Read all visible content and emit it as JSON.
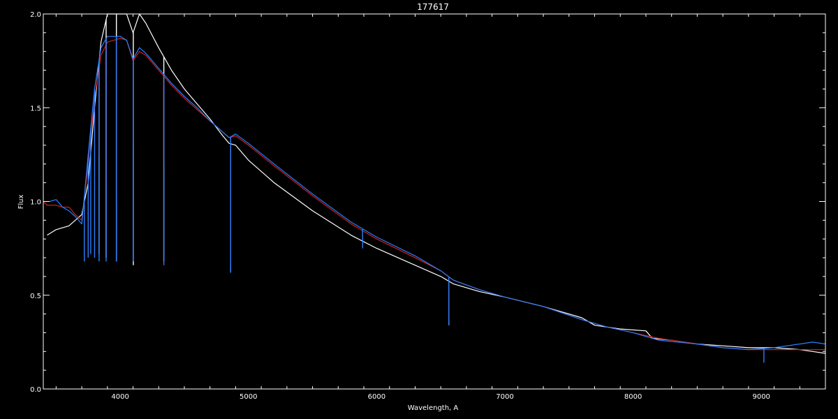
{
  "chart_data": {
    "type": "line",
    "title": "177617",
    "xlabel": "Wavelength, A",
    "ylabel": "Flux",
    "xlim": [
      3400,
      9500
    ],
    "ylim": [
      0.0,
      2.0
    ],
    "xticks": [
      4000,
      5000,
      6000,
      7000,
      8000,
      9000
    ],
    "xtick_labels": [
      "4000",
      "5000",
      "6000",
      "7000",
      "8000",
      "9000"
    ],
    "yticks": [
      0.0,
      0.5,
      1.0,
      1.5,
      2.0
    ],
    "ytick_labels": [
      "0.0",
      "0.5",
      "1.0",
      "1.5",
      "2.0"
    ],
    "grid": false,
    "background": "#000000",
    "axis_color": "#ffffff",
    "series": [
      {
        "color": "#ffffff",
        "x": [
          3400,
          3430,
          3500,
          3600,
          3700,
          3750,
          3800,
          3850,
          3900,
          3950,
          4000,
          4050,
          4100,
          4150,
          4200,
          4300,
          4400,
          4500,
          4600,
          4700,
          4800,
          4850,
          4900,
          5000,
          5200,
          5500,
          5800,
          6000,
          6300,
          6500,
          6600,
          6800,
          7000,
          7300,
          7600,
          7700,
          7900,
          8100,
          8150,
          8300,
          8500,
          8700,
          8900,
          9100,
          9300,
          9400,
          9500
        ],
        "y": [
          null,
          0.82,
          0.85,
          0.87,
          0.93,
          1.1,
          1.5,
          1.85,
          2.0,
          2.0,
          2.0,
          2.0,
          1.9,
          2.0,
          1.95,
          1.82,
          1.7,
          1.6,
          1.52,
          1.44,
          1.35,
          1.31,
          1.3,
          1.22,
          1.1,
          0.95,
          0.82,
          0.75,
          0.66,
          0.6,
          0.56,
          0.52,
          0.49,
          0.44,
          0.38,
          0.34,
          0.32,
          0.31,
          0.27,
          0.26,
          0.24,
          0.23,
          0.22,
          0.22,
          0.21,
          0.2,
          0.19
        ],
        "absorption": [
          [
            3835,
            0.72
          ],
          [
            3890,
            0.7
          ],
          [
            3970,
            0.68
          ],
          [
            4102,
            0.66
          ],
          [
            4340,
            0.68
          ],
          [
            4861,
            0.62
          ],
          [
            6563,
            0.34
          ]
        ]
      },
      {
        "color": "#cc2020",
        "x": [
          3400,
          3430,
          3500,
          3550,
          3600,
          3650,
          3700,
          3750,
          3800,
          3850,
          3900,
          3950,
          4000,
          4050,
          4100,
          4150,
          4200,
          4300,
          4400,
          4500,
          4600,
          4700,
          4800,
          4850,
          4900,
          5000,
          5200,
          5500,
          5800,
          6000,
          6300,
          6500,
          6600,
          6800,
          7000,
          7300,
          7600,
          7800,
          8000,
          8200,
          8500,
          8700,
          8900,
          9100,
          9300,
          9500
        ],
        "y": [
          1.0,
          0.98,
          0.98,
          0.97,
          0.97,
          0.93,
          0.9,
          1.2,
          1.55,
          1.78,
          1.85,
          1.86,
          1.87,
          1.86,
          1.75,
          1.8,
          1.78,
          1.7,
          1.62,
          1.55,
          1.49,
          1.43,
          1.37,
          1.34,
          1.35,
          1.3,
          1.19,
          1.03,
          0.88,
          0.8,
          0.7,
          0.63,
          0.58,
          0.53,
          0.49,
          0.44,
          0.37,
          0.33,
          0.3,
          0.27,
          0.24,
          0.22,
          0.21,
          0.21,
          0.21,
          0.21
        ],
        "absorption": [
          [
            3835,
            1.25
          ],
          [
            3890,
            1.1
          ],
          [
            3970,
            1.0
          ],
          [
            4102,
            1.3
          ],
          [
            4340,
            1.2
          ],
          [
            4861,
            0.66
          ],
          [
            6563,
            0.36
          ]
        ]
      },
      {
        "color": "#2a7fff",
        "x": [
          3400,
          3450,
          3500,
          3550,
          3600,
          3650,
          3700,
          3750,
          3800,
          3850,
          3900,
          3950,
          4000,
          4050,
          4100,
          4150,
          4200,
          4300,
          4400,
          4500,
          4600,
          4700,
          4800,
          4850,
          4900,
          5000,
          5200,
          5500,
          5800,
          6000,
          6300,
          6500,
          6600,
          6800,
          7000,
          7300,
          7600,
          7800,
          8000,
          8200,
          8500,
          8700,
          8900,
          9100,
          9300,
          9400,
          9500
        ],
        "y": [
          null,
          1.0,
          1.01,
          0.97,
          0.95,
          0.92,
          0.88,
          1.25,
          1.6,
          1.82,
          1.88,
          1.88,
          1.88,
          1.86,
          1.76,
          1.82,
          1.79,
          1.71,
          1.63,
          1.56,
          1.5,
          1.43,
          1.37,
          1.34,
          1.36,
          1.31,
          1.2,
          1.04,
          0.89,
          0.81,
          0.71,
          0.63,
          0.58,
          0.53,
          0.49,
          0.44,
          0.37,
          0.33,
          0.3,
          0.26,
          0.24,
          0.22,
          0.21,
          0.22,
          0.24,
          0.25,
          0.24
        ],
        "absorption": [
          [
            3720,
            0.68
          ],
          [
            3750,
            0.7
          ],
          [
            3770,
            0.72
          ],
          [
            3800,
            0.7
          ],
          [
            3835,
            0.68
          ],
          [
            3890,
            0.68
          ],
          [
            3970,
            0.68
          ],
          [
            4102,
            0.68
          ],
          [
            4340,
            0.66
          ],
          [
            4861,
            0.62
          ],
          [
            5890,
            0.75
          ],
          [
            6563,
            0.34
          ],
          [
            9020,
            0.14
          ]
        ]
      }
    ]
  }
}
